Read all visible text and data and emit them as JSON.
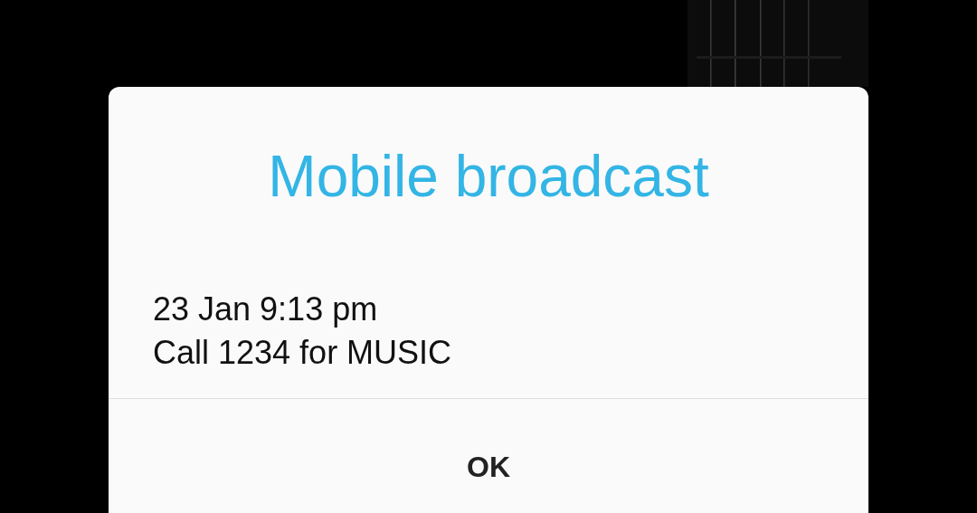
{
  "dialog": {
    "title": "Mobile broadcast",
    "message_lines": [
      "23 Jan 9:13 pm",
      "Call 1234 for MUSIC"
    ],
    "buttons": [
      "OK"
    ]
  }
}
